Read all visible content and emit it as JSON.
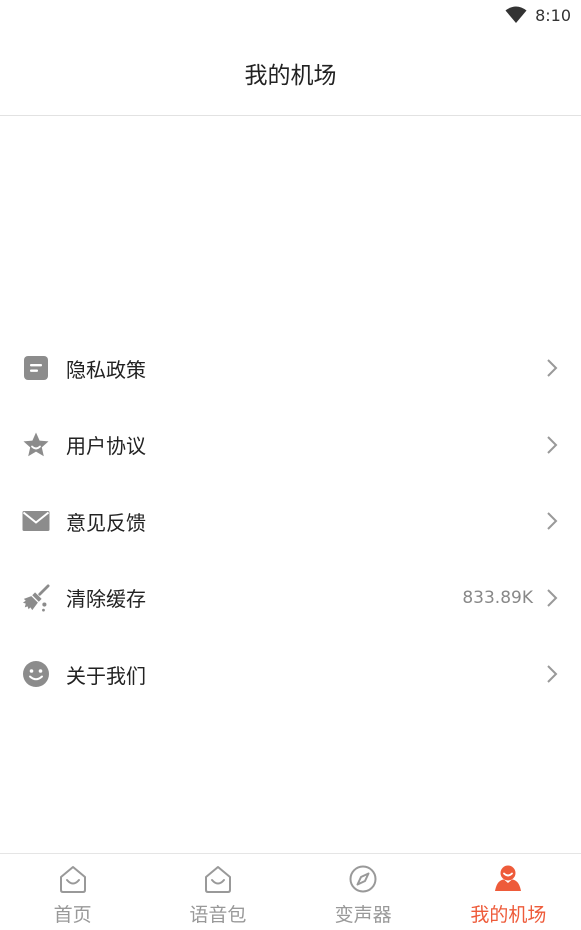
{
  "status_bar": {
    "time": "8:10"
  },
  "header": {
    "title": "我的机场"
  },
  "menu": {
    "items": [
      {
        "label": "隐私政策",
        "value": "",
        "icon": "document-icon"
      },
      {
        "label": "用户协议",
        "value": "",
        "icon": "star-icon"
      },
      {
        "label": "意见反馈",
        "value": "",
        "icon": "mail-icon"
      },
      {
        "label": "清除缓存",
        "value": "833.89K",
        "icon": "broom-icon"
      },
      {
        "label": "关于我们",
        "value": "",
        "icon": "smiley-icon"
      }
    ]
  },
  "tabs": [
    {
      "label": "首页",
      "icon": "home-icon",
      "active": false
    },
    {
      "label": "语音包",
      "icon": "voice-pack-icon",
      "active": false
    },
    {
      "label": "变声器",
      "icon": "compass-icon",
      "active": false
    },
    {
      "label": "我的机场",
      "icon": "profile-icon",
      "active": true
    }
  ],
  "colors": {
    "accent": "#ee5b3a",
    "icon_gray": "#8c8c8c",
    "inactive_tab": "#999999"
  }
}
